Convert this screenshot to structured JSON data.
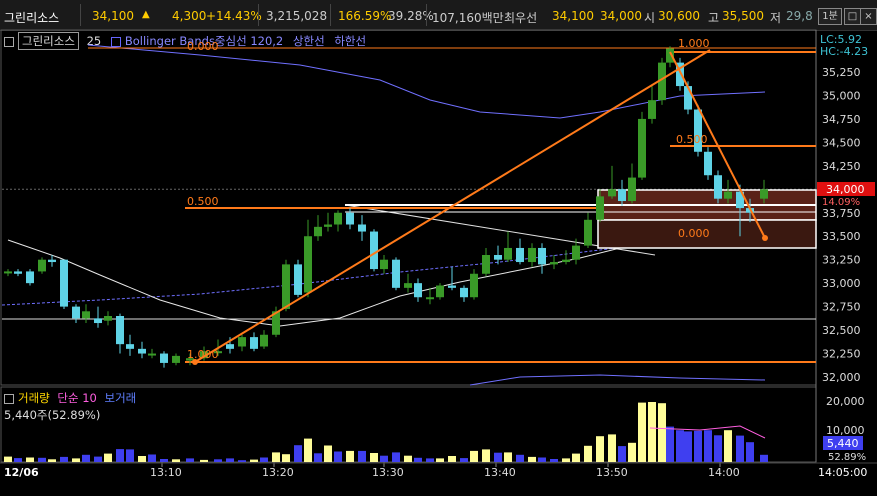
{
  "topbar": {
    "name": "그린리소스",
    "price": "34,100",
    "change": "4,300",
    "change_pct": "+14.43%",
    "volume": "3,215,028",
    "vol_ratio": "166.59%",
    "turnover": "39.28%",
    "amount": "107,160백만",
    "best_ask_label": "최우선",
    "best_ask": "34,100",
    "best_bid": "34,000",
    "open_label": "시",
    "open": "30,600",
    "high_label": "고",
    "high": "35,500",
    "low_label": "저",
    "low": "29,8",
    "interval_badge": "1분"
  },
  "legend": {
    "symbol": "그린리소스",
    "period": "25",
    "indicator": "Bollinger Bands중심선 120,2",
    "upper": "상한선",
    "lower": "하한선"
  },
  "axis": {
    "lc": "LC:5.92",
    "hc": "HC:-4.23",
    "price_ticks": [
      "35,250",
      "35,000",
      "34,750",
      "34,500",
      "34,250",
      "33,750",
      "33,500",
      "33,250",
      "33,000",
      "32,750",
      "32,500",
      "32,250",
      "32,000"
    ],
    "current_price": "34,000",
    "current_pct": "14.09%",
    "vol_ticks": [
      "20,000",
      "10,000"
    ],
    "vol_current": "5,440",
    "vol_pct": "52.89%",
    "times": [
      "12/06",
      "13:10",
      "13:20",
      "13:30",
      "13:40",
      "13:50",
      "14:00",
      "14:05:00"
    ]
  },
  "fib": {
    "up_start": "1.000",
    "up_mid": "0.500",
    "up_top": "0.000",
    "down_top": "1.000",
    "down_mid": "0.500",
    "down_bottom": "0.000"
  },
  "volume_legend": {
    "label": "거래량",
    "ma": "단순 10",
    "ma2": "보거래",
    "current": "5,440주(52.89%)"
  },
  "colors": {
    "up": "#3a9a28",
    "down": "#5fd3e6",
    "fib": "#ff7a1a",
    "vol_up": "#fffd99",
    "vol_down": "#3f3ff0",
    "ma": "#ffffff",
    "bb": "#8888ff"
  }
}
